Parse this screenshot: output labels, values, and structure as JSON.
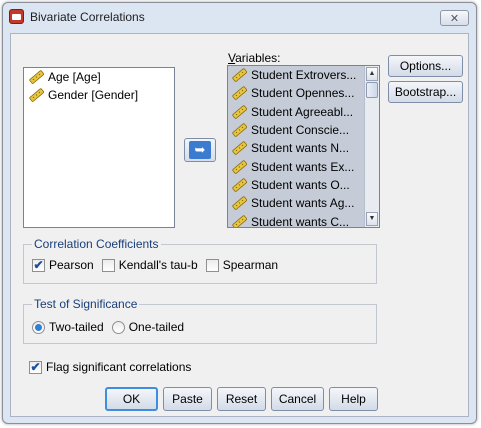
{
  "window": {
    "title": "Bivariate Correlations",
    "close_glyph": "✕"
  },
  "source_list": {
    "items": [
      {
        "label": "Age [Age]",
        "icon": "scale-ruler-icon"
      },
      {
        "label": "Gender [Gender]",
        "icon": "scale-ruler-icon"
      }
    ]
  },
  "move_button": {
    "icon": "arrow-left-icon",
    "glyph": "➥"
  },
  "variables": {
    "label": "Variables:",
    "items": [
      {
        "label": "Student Extrovers..."
      },
      {
        "label": "Student Opennes..."
      },
      {
        "label": "Student Agreeabl..."
      },
      {
        "label": "Student Conscie..."
      },
      {
        "label": "Student wants N..."
      },
      {
        "label": "Student wants Ex..."
      },
      {
        "label": "Student wants O..."
      },
      {
        "label": "Student wants Ag..."
      },
      {
        "label": "Student wants C..."
      }
    ],
    "scroll_up_glyph": "▲",
    "scroll_down_glyph": "▼"
  },
  "side_buttons": {
    "options": "Options...",
    "bootstrap": "Bootstrap..."
  },
  "correlation_coefficients": {
    "title": "Correlation Coefficients",
    "pearson": {
      "label": "Pearson",
      "checked": true
    },
    "kendall": {
      "label": "Kendall's tau-b",
      "checked": false
    },
    "spearman": {
      "label": "Spearman",
      "checked": false
    },
    "check_glyph": "✔"
  },
  "test_of_significance": {
    "title": "Test of Significance",
    "two_tailed": {
      "label": "Two-tailed",
      "selected": true
    },
    "one_tailed": {
      "label": "One-tailed",
      "selected": false
    }
  },
  "flag_significant": {
    "label": "Flag significant correlations",
    "checked": true
  },
  "buttons": {
    "ok": "OK",
    "paste": "Paste",
    "reset": "Reset",
    "cancel": "Cancel",
    "help": "Help"
  },
  "colors": {
    "accent": "#3b7bd0",
    "group_title": "#1a3f7a",
    "selection": "#c5ccd8"
  }
}
